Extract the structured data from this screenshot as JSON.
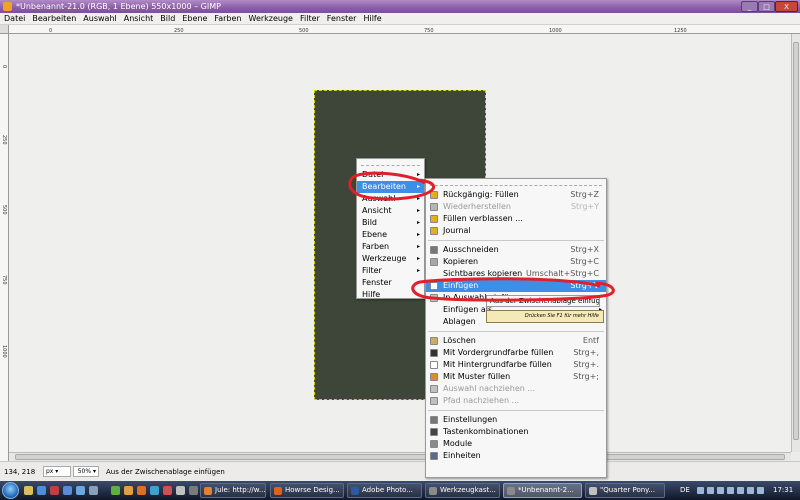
{
  "window": {
    "title": "*Unbenannt-21.0 (RGB, 1 Ebene) 550x1000 – GIMP",
    "controls": {
      "min": "_",
      "max": "□",
      "close": "X"
    }
  },
  "menubar": [
    "Datei",
    "Bearbeiten",
    "Auswahl",
    "Ansicht",
    "Bild",
    "Ebene",
    "Farben",
    "Werkzeuge",
    "Filter",
    "Fenster",
    "Hilfe"
  ],
  "ruler": {
    "x_ticks": [
      "0",
      "250",
      "500",
      "750",
      "1000",
      "1250"
    ],
    "y_ticks": [
      "0",
      "250",
      "500",
      "750",
      "1000"
    ]
  },
  "canvas": {
    "image_color": "#3d4639"
  },
  "main_menu": {
    "items": [
      {
        "label": "Datei",
        "submenu": true
      },
      {
        "label": "Bearbeiten",
        "submenu": true,
        "highlight": true
      },
      {
        "label": "Auswahl",
        "submenu": true
      },
      {
        "label": "Ansicht",
        "submenu": true
      },
      {
        "label": "Bild",
        "submenu": true
      },
      {
        "label": "Ebene",
        "submenu": true
      },
      {
        "label": "Farben",
        "submenu": true
      },
      {
        "label": "Werkzeuge",
        "submenu": true
      },
      {
        "label": "Filter",
        "submenu": true
      },
      {
        "label": "Fenster",
        "submenu": true
      },
      {
        "label": "Hilfe",
        "submenu": true
      }
    ]
  },
  "edit_menu": {
    "items": [
      {
        "label": "Rückgängig: Füllen",
        "shortcut": "Strg+Z",
        "icon": "undo-icon",
        "icon_color": "#e0b020"
      },
      {
        "label": "Wiederherstellen",
        "shortcut": "Strg+Y",
        "icon": "redo-icon",
        "icon_color": "#b5b5b5",
        "disabled": true
      },
      {
        "label": "Füllen verblassen ...",
        "shortcut": "",
        "icon": "fade-icon",
        "icon_color": "#e0b020"
      },
      {
        "label": "Journal",
        "shortcut": "",
        "icon": "journal-icon",
        "icon_color": "#e0b020"
      },
      {
        "sep": true
      },
      {
        "label": "Ausschneiden",
        "shortcut": "Strg+X",
        "icon": "cut-icon",
        "icon_color": "#777777"
      },
      {
        "label": "Kopieren",
        "shortcut": "Strg+C",
        "icon": "copy-icon",
        "icon_color": "#a8a8a8"
      },
      {
        "label": "Sichtbares kopieren",
        "shortcut": "Umschalt+Strg+C",
        "icon": "",
        "icon_color": ""
      },
      {
        "label": "Einfügen",
        "shortcut": "Strg+V",
        "icon": "paste-icon",
        "icon_color": "#ffffff",
        "highlight": true
      },
      {
        "label": "In Auswahl einfügen",
        "shortcut": "",
        "icon": "paste-into-icon",
        "icon_color": "#c0c0c0"
      },
      {
        "label": "Einfügen als",
        "shortcut": "",
        "submenu": true,
        "icon": "",
        "icon_color": ""
      },
      {
        "label": "Ablagen",
        "shortcut": "",
        "submenu": true,
        "icon": "",
        "icon_color": ""
      },
      {
        "sep": true
      },
      {
        "label": "Löschen",
        "shortcut": "Entf",
        "icon": "clear-icon",
        "icon_color": "#c8b060"
      },
      {
        "label": "Mit Vordergrundfarbe füllen",
        "shortcut": "Strg+,",
        "icon": "fg-fill-icon",
        "icon_color": "#333333"
      },
      {
        "label": "Mit Hintergrundfarbe füllen",
        "shortcut": "Strg+.",
        "icon": "bg-fill-icon",
        "icon_color": "#ffffff"
      },
      {
        "label": "Mit Muster füllen",
        "shortcut": "Strg+;",
        "icon": "pattern-fill-icon",
        "icon_color": "#e08a30"
      },
      {
        "label": "Auswahl nachziehen ...",
        "shortcut": "",
        "icon": "stroke-selection-icon",
        "icon_color": "#c0c0c0",
        "disabled": true
      },
      {
        "label": "Pfad nachziehen ...",
        "shortcut": "",
        "icon": "stroke-path-icon",
        "icon_color": "#c0c0c0",
        "disabled": true
      },
      {
        "sep": true
      },
      {
        "label": "Einstellungen",
        "shortcut": "",
        "icon": "preferences-icon",
        "icon_color": "#777777"
      },
      {
        "label": "Tastenkombinationen",
        "shortcut": "",
        "icon": "keyboard-icon",
        "icon_color": "#444444"
      },
      {
        "label": "Module",
        "shortcut": "",
        "icon": "modules-icon",
        "icon_color": "#8a8a8a"
      },
      {
        "label": "Einheiten",
        "shortcut": "",
        "icon": "units-icon",
        "icon_color": "#5a6a8a"
      }
    ]
  },
  "tooltip": {
    "title": "Aus der Zwischenablage einfügen",
    "hint": "Drücken Sie F1 für mehr Hilfe"
  },
  "statusbar": {
    "coords": "134, 218",
    "unit": "px",
    "zoom": "50%",
    "message": "Aus der Zwischenablage einfügen"
  },
  "taskbar": {
    "buttons": [
      {
        "label": "Jule: http://w...",
        "color": "#e08030",
        "active": false
      },
      {
        "label": "Howrse Desig...",
        "color": "#e06020",
        "active": false
      },
      {
        "label": "Adobe Photo...",
        "color": "#2a5aa0",
        "active": false
      },
      {
        "label": "Werkzeugkast...",
        "color": "#8a8a8a",
        "active": false
      },
      {
        "label": "*Unbenannt-2...",
        "color": "#8a8a8a",
        "active": true
      },
      {
        "label": "\"Quarter Pony...",
        "color": "#c0c0c0",
        "active": false
      }
    ],
    "lang": "DE",
    "time": "17:31"
  },
  "annotation_color": "#e0202a"
}
